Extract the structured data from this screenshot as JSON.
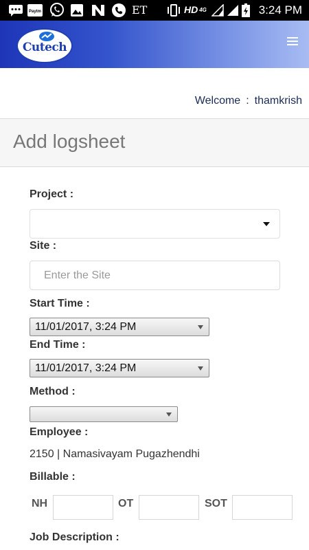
{
  "status_bar": {
    "time": "3:24 PM",
    "network": "HD",
    "network_gen": "4G",
    "icons": [
      "messaging-icon",
      "paytm-icon",
      "whatsapp-icon",
      "gallery-icon",
      "n-app-icon",
      "phone-icon",
      "et-icon",
      "vibrate-icon",
      "signal-icon",
      "signal-icon",
      "battery-icon"
    ],
    "et_label": "ET",
    "paytm_label": "Paytm"
  },
  "header": {
    "logo_text": "Cutech",
    "gradient_start": "#1e35b8",
    "gradient_end": "#a8bcf2"
  },
  "welcome": {
    "label": "Welcome",
    "separator": ":",
    "username": "thamkrish"
  },
  "page_title": "Add logsheet",
  "form": {
    "project": {
      "label": "Project :",
      "value": ""
    },
    "site": {
      "label": "Site :",
      "placeholder": "Enter the Site",
      "value": ""
    },
    "start_time": {
      "label": "Start Time :",
      "value": "11/01/2017, 3:24 PM"
    },
    "end_time": {
      "label": "End Time :",
      "value": "11/01/2017, 3:24 PM"
    },
    "method": {
      "label": "Method :",
      "value": ""
    },
    "employee": {
      "label": "Employee :",
      "value": "2150 | Namasivayam Pugazhendhi"
    },
    "billable": {
      "label": "Billable :",
      "nh_label": "NH",
      "ot_label": "OT",
      "sot_label": "SOT"
    },
    "job_description": {
      "label": "Job Description :"
    }
  }
}
